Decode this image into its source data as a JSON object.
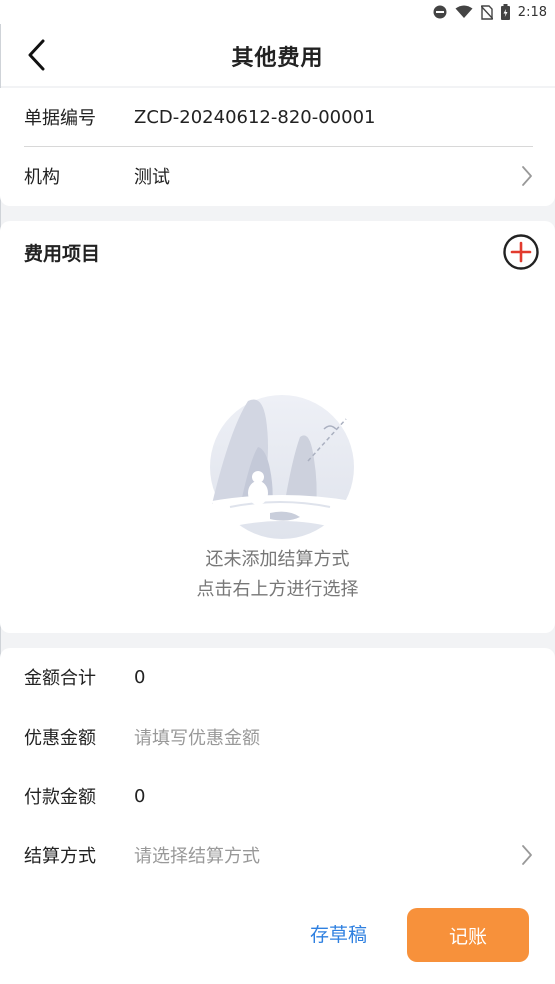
{
  "status_bar": {
    "time": "2:18"
  },
  "header": {
    "title": "其他费用"
  },
  "document": {
    "number_label": "单据编号",
    "number_value": "ZCD-20240612-820-00001",
    "org_label": "机构",
    "org_value": "测试"
  },
  "items": {
    "title": "费用项目",
    "empty_line1": "还未添加结算方式",
    "empty_line2": "点击右上方进行选择"
  },
  "summary": {
    "total_label": "金额合计",
    "total_value": "0",
    "discount_label": "优惠金额",
    "discount_placeholder": "请填写优惠金额",
    "payment_label": "付款金额",
    "payment_value": "0",
    "settlement_label": "结算方式",
    "settlement_placeholder": "请选择结算方式"
  },
  "actions": {
    "draft_label": "存草稿",
    "post_label": "记账"
  },
  "colors": {
    "accent_orange": "#f7913b",
    "link_blue": "#2f80e0",
    "add_red": "#e23b2e"
  }
}
